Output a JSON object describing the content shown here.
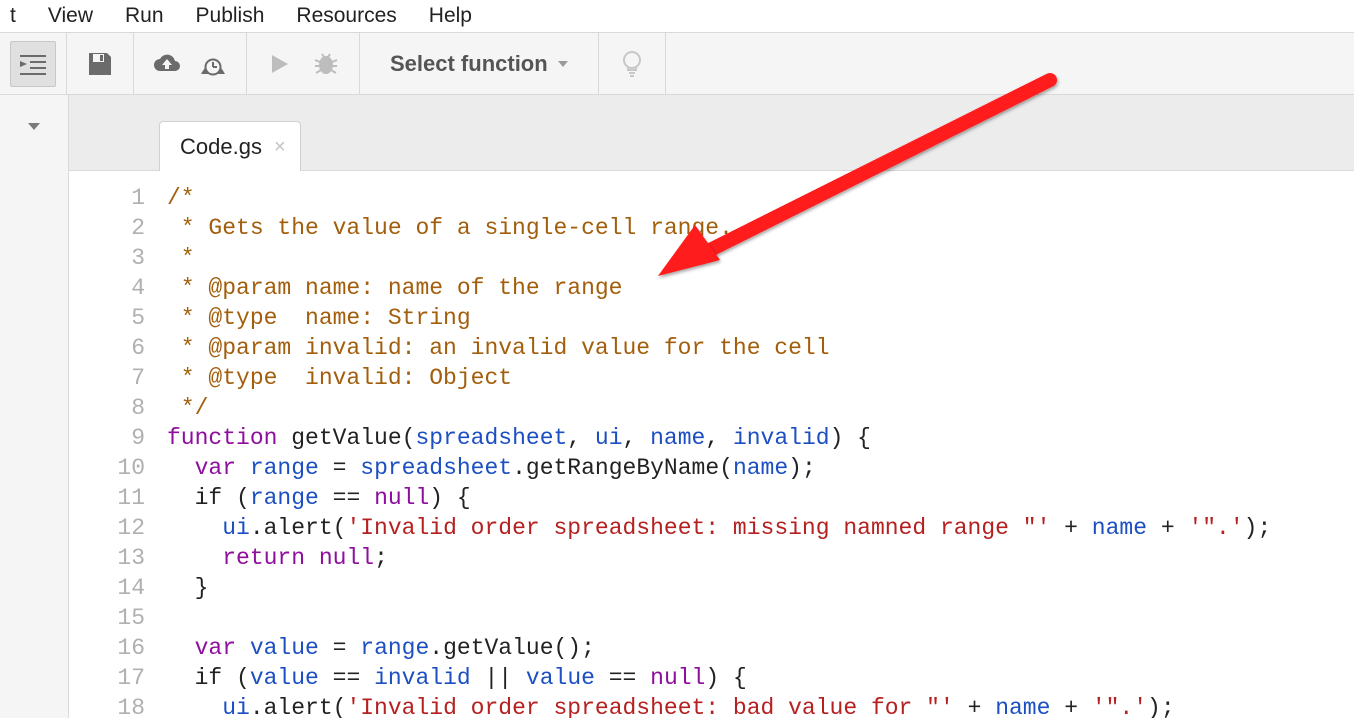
{
  "menubar": {
    "items": [
      "t",
      "View",
      "Run",
      "Publish",
      "Resources",
      "Help"
    ]
  },
  "toolbar": {
    "select_fn_label": "Select function"
  },
  "tabs": [
    {
      "label": "Code.gs"
    }
  ],
  "gutter": {
    "start": 1,
    "end": 18
  },
  "code": {
    "lines": [
      {
        "comment": "/*"
      },
      {
        "comment": " * Gets the value of a single-cell range."
      },
      {
        "comment": " *"
      },
      {
        "comment": " * @param name: name of the range"
      },
      {
        "comment": " * @type  name: String"
      },
      {
        "comment": " * @param invalid: an invalid value for the cell"
      },
      {
        "comment": " * @type  invalid: Object"
      },
      {
        "comment": " */"
      },
      {
        "kw": "function",
        "def": "getValue",
        "params": [
          "spreadsheet",
          "ui",
          "name",
          "invalid"
        ],
        "open_brace": true
      },
      {
        "indent": 1,
        "kw": "var",
        "lhs": "range",
        "eq": " = ",
        "rhs_var1": "spreadsheet",
        "rhs_call": ".getRangeByName(",
        "rhs_arg": "name",
        "rhs_tail": ");"
      },
      {
        "indent": 1,
        "plain_pre": "if (",
        "var1": "range",
        "plain_mid": " == ",
        "kw2": "null",
        "plain_post": ") {"
      },
      {
        "indent": 2,
        "var1": "ui",
        "plain1": ".alert(",
        "str1": "'Invalid order spreadsheet: missing namned range \"'",
        "plain2": " + ",
        "var2": "name",
        "plain3": " + ",
        "str2": "'\".'",
        "plain4": ");"
      },
      {
        "indent": 2,
        "kw": "return",
        "space": " ",
        "kw2": "null",
        "tail": ";"
      },
      {
        "indent": 1,
        "plain": "}"
      },
      {
        "blank": true
      },
      {
        "indent": 1,
        "kw": "var",
        "lhs": "value",
        "eq": " = ",
        "rhs_var1": "range",
        "rhs_call": ".getValue();",
        "rhs_arg": "",
        "rhs_tail": ""
      },
      {
        "indent": 1,
        "plain_pre": "if (",
        "var1": "value",
        "plain_mid": " == ",
        "var2": "invalid",
        "plain_mid2": " || ",
        "var3": "value",
        "plain_mid3": " == ",
        "kw2": "null",
        "plain_post": ") {"
      },
      {
        "indent": 2,
        "var1": "ui",
        "plain1": ".alert(",
        "str1": "'Invalid order spreadsheet: bad value for \"'",
        "plain2": " + ",
        "var2": "name",
        "plain3": " + ",
        "str2": "'\".'",
        "plain4": ");",
        "cutoff": true
      }
    ]
  }
}
